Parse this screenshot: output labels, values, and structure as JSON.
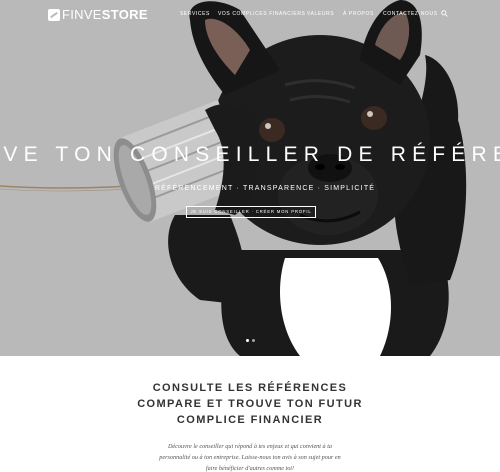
{
  "brand": {
    "logo_light": "FINVE",
    "logo_bold": "STORE"
  },
  "nav": {
    "items": [
      {
        "label": "Services"
      },
      {
        "label": "Vos complices financiers"
      },
      {
        "label": "Valeurs"
      },
      {
        "label": "À propos"
      },
      {
        "label": "Contactez-nous"
      }
    ],
    "search_icon": "search-icon"
  },
  "hero": {
    "headline": "UVE TON CONSEILLER DE RÉFÉREN",
    "tagline": "Référencement · Transparence · Simplicité",
    "cta_label": "Je suis conseiller · Créer mon profil",
    "slides": 2,
    "active_slide": 1,
    "background_color": "#b9b9b9"
  },
  "intro": {
    "title_lines": [
      "Consulte les références",
      "compare et trouve ton futur",
      "complice financier"
    ],
    "body_lines": [
      "Découvre le conseiller qui répond à tes enjeux et qui convient à ta",
      "personnalité ou à ton entreprise. Laisse-nous ton avis à son sujet pour en",
      "faire bénéficier d'autres comme toi!"
    ]
  }
}
